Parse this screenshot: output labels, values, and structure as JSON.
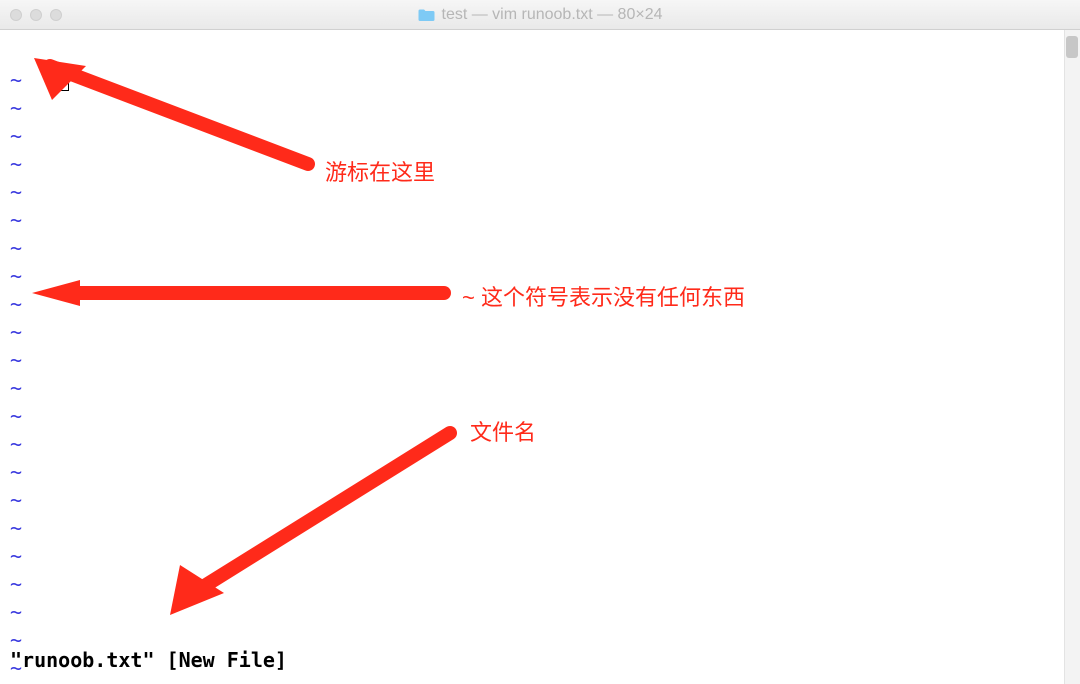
{
  "titlebar": {
    "title": "test — vim runoob.txt — 80×24",
    "folder_icon": "folder-icon"
  },
  "terminal": {
    "tilde_char": "~",
    "tilde_lines": 22,
    "status": "\"runoob.txt\" [New File]"
  },
  "annotations": {
    "cursor_label": "游标在这里",
    "tilde_label": "~ 这个符号表示没有任何东西",
    "filename_label": "文件名"
  },
  "colors": {
    "red": "#ff2a1a",
    "tilde": "#3a3adf"
  }
}
